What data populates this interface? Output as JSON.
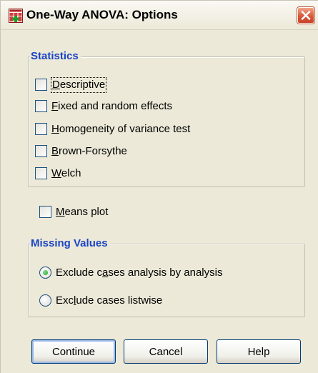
{
  "window": {
    "title": "One-Way ANOVA: Options"
  },
  "statistics": {
    "title": "Statistics",
    "items": [
      {
        "pre": "",
        "mnemonic": "D",
        "post": "escriptive",
        "checked": false,
        "focused": true
      },
      {
        "pre": "",
        "mnemonic": "F",
        "post": "ixed and random effects",
        "checked": false,
        "focused": false
      },
      {
        "pre": "",
        "mnemonic": "H",
        "post": "omogeneity of variance test",
        "checked": false,
        "focused": false
      },
      {
        "pre": "",
        "mnemonic": "B",
        "post": "rown-Forsythe",
        "checked": false,
        "focused": false
      },
      {
        "pre": "",
        "mnemonic": "W",
        "post": "elch",
        "checked": false,
        "focused": false
      }
    ]
  },
  "means_plot": {
    "pre": "",
    "mnemonic": "M",
    "post": "eans plot",
    "checked": false
  },
  "missing_values": {
    "title": "Missing Values",
    "options": [
      {
        "pre": "Exclude c",
        "mnemonic": "a",
        "post": "ses analysis by analysis",
        "selected": true
      },
      {
        "pre": "Exc",
        "mnemonic": "l",
        "post": "ude cases listwise",
        "selected": false
      }
    ]
  },
  "buttons": {
    "continue": "Continue",
    "cancel": "Cancel",
    "help": "Help"
  },
  "colors": {
    "group_title": "#1a44c4",
    "dialog_bg": "#ece9d8",
    "close_button": "#d7593a"
  },
  "icons": {
    "title_icon": "spss-dialog-icon",
    "close": "close-icon"
  }
}
